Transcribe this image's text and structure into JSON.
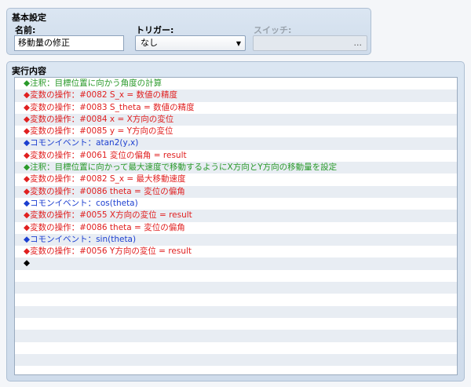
{
  "basic_settings": {
    "title": "基本設定",
    "name_label": "名前:",
    "name_value": "移動量の修正",
    "trigger_label": "トリガー:",
    "trigger_value": "なし",
    "switch_label": "スイッチ:",
    "switch_button": "..."
  },
  "content": {
    "title": "実行内容",
    "commands": [
      {
        "text": "◆注釈：目標位置に向かう角度の計算",
        "color": "green"
      },
      {
        "text": "◆変数の操作：#0082 S_x = 数値の精度",
        "color": "red"
      },
      {
        "text": "◆変数の操作：#0083 S_theta = 数値の精度",
        "color": "red"
      },
      {
        "text": "◆変数の操作：#0084 x = X方向の変位",
        "color": "red"
      },
      {
        "text": "◆変数の操作：#0085 y = Y方向の変位",
        "color": "red"
      },
      {
        "text": "◆コモンイベント：atan2(y,x)",
        "color": "blue"
      },
      {
        "text": "◆変数の操作：#0061 変位の偏角 = result",
        "color": "red"
      },
      {
        "text": "◆注釈：目標位置に向かって最大速度で移動するようにX方向とY方向の移動量を設定",
        "color": "green"
      },
      {
        "text": "◆変数の操作：#0082 S_x = 最大移動速度",
        "color": "red"
      },
      {
        "text": "◆変数の操作：#0086 theta = 変位の偏角",
        "color": "red"
      },
      {
        "text": "◆コモンイベント：cos(theta)",
        "color": "blue"
      },
      {
        "text": "◆変数の操作：#0055 X方向の変位 = result",
        "color": "red"
      },
      {
        "text": "◆変数の操作：#0086 theta = 変位の偏角",
        "color": "red"
      },
      {
        "text": "◆コモンイベント：sin(theta)",
        "color": "blue"
      },
      {
        "text": "◆変数の操作：#0056 Y方向の変位 = result",
        "color": "red"
      },
      {
        "text": "◆",
        "color": "black"
      }
    ]
  },
  "colors": {
    "comment": "#2a9a2a",
    "variable_op": "#e02020",
    "common_event": "#1c3fd0"
  }
}
